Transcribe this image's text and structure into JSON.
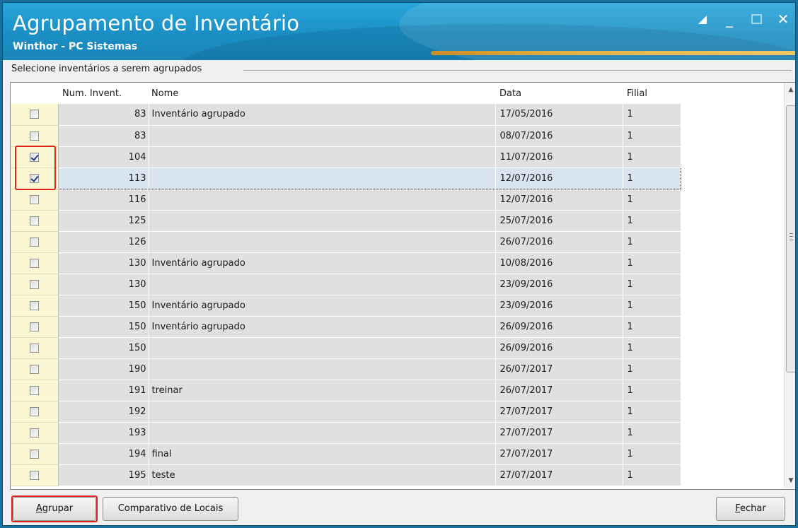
{
  "window": {
    "title": "Agrupamento de Inventário",
    "subtitle": "Winthor - PC Sistemas"
  },
  "group_label": "Selecione inventários a serem agrupados",
  "table": {
    "headers": {
      "num": "Num. Invent.",
      "nome": "Nome",
      "data": "Data",
      "filial": "Filial"
    },
    "rows": [
      {
        "checked": false,
        "num": "83",
        "nome": "Inventário agrupado",
        "data": "17/05/2016",
        "filial": "1"
      },
      {
        "checked": false,
        "num": "83",
        "nome": "",
        "data": "08/07/2016",
        "filial": "1"
      },
      {
        "checked": true,
        "num": "104",
        "nome": "",
        "data": "11/07/2016",
        "filial": "1"
      },
      {
        "checked": true,
        "num": "113",
        "nome": "",
        "data": "12/07/2016",
        "filial": "1"
      },
      {
        "checked": false,
        "num": "116",
        "nome": "",
        "data": "12/07/2016",
        "filial": "1"
      },
      {
        "checked": false,
        "num": "125",
        "nome": "",
        "data": "25/07/2016",
        "filial": "1"
      },
      {
        "checked": false,
        "num": "126",
        "nome": "",
        "data": "26/07/2016",
        "filial": "1"
      },
      {
        "checked": false,
        "num": "130",
        "nome": "Inventário agrupado",
        "data": "10/08/2016",
        "filial": "1"
      },
      {
        "checked": false,
        "num": "130",
        "nome": "",
        "data": "23/09/2016",
        "filial": "1"
      },
      {
        "checked": false,
        "num": "150",
        "nome": "Inventário agrupado",
        "data": "23/09/2016",
        "filial": "1"
      },
      {
        "checked": false,
        "num": "150",
        "nome": "Inventário agrupado",
        "data": "26/09/2016",
        "filial": "1"
      },
      {
        "checked": false,
        "num": "150",
        "nome": "",
        "data": "26/09/2016",
        "filial": "1"
      },
      {
        "checked": false,
        "num": "190",
        "nome": "",
        "data": "26/07/2017",
        "filial": "1"
      },
      {
        "checked": false,
        "num": "191",
        "nome": "treinar",
        "data": "26/07/2017",
        "filial": "1"
      },
      {
        "checked": false,
        "num": "192",
        "nome": "",
        "data": "27/07/2017",
        "filial": "1"
      },
      {
        "checked": false,
        "num": "193",
        "nome": "",
        "data": "27/07/2017",
        "filial": "1"
      },
      {
        "checked": false,
        "num": "194",
        "nome": "final",
        "data": "27/07/2017",
        "filial": "1"
      },
      {
        "checked": false,
        "num": "195",
        "nome": "teste",
        "data": "27/07/2017",
        "filial": "1"
      }
    ],
    "selected_row": 3
  },
  "buttons": {
    "agrupar": {
      "first": "A",
      "rest": "grupar"
    },
    "comparativo": "Comparativo de Locais",
    "fechar": {
      "first": "F",
      "rest": "echar"
    }
  },
  "colors": {
    "title_bar": "#1b8fc4",
    "accent": "#e4b24a",
    "highlight": "#e0201c",
    "check_column": "#fbf7d2"
  }
}
